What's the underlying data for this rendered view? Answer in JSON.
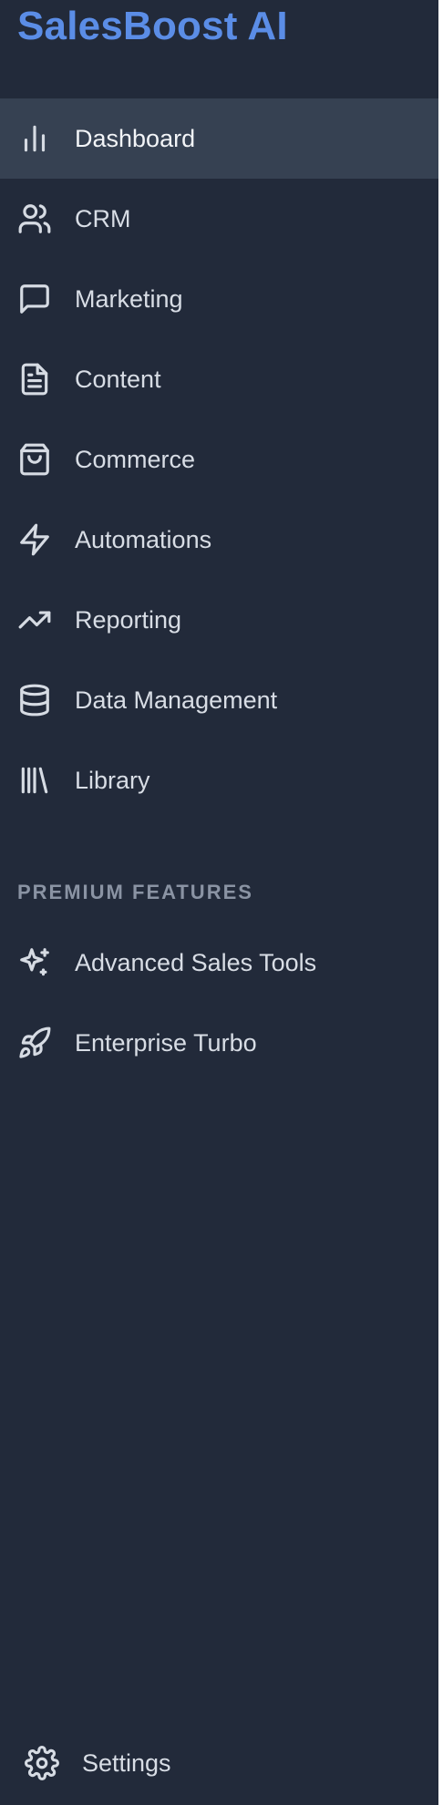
{
  "sidebar": {
    "brand": "SalesBoost AI",
    "items": [
      {
        "label": "Dashboard",
        "icon": "bar-chart-icon",
        "active": true
      },
      {
        "label": "CRM",
        "icon": "users-icon"
      },
      {
        "label": "Marketing",
        "icon": "message-square-icon"
      },
      {
        "label": "Content",
        "icon": "file-text-icon"
      },
      {
        "label": "Commerce",
        "icon": "shopping-bag-icon"
      },
      {
        "label": "Automations",
        "icon": "zap-icon"
      },
      {
        "label": "Reporting",
        "icon": "trending-up-icon"
      },
      {
        "label": "Data Management",
        "icon": "database-icon"
      },
      {
        "label": "Library",
        "icon": "library-icon"
      }
    ],
    "premium": {
      "heading": "PREMIUM FEATURES",
      "items": [
        {
          "label": "Advanced Sales Tools",
          "icon": "sparkles-icon"
        },
        {
          "label": "Enterprise Turbo",
          "icon": "rocket-icon"
        }
      ]
    },
    "footer": {
      "settings_label": "Settings",
      "icon": "gear-icon"
    }
  },
  "colors": {
    "sidebar_bg": "#222a3a",
    "active_bg": "#364152",
    "brand": "#5b8de6",
    "text": "#d8dde5",
    "section_heading": "#8a93a3"
  }
}
